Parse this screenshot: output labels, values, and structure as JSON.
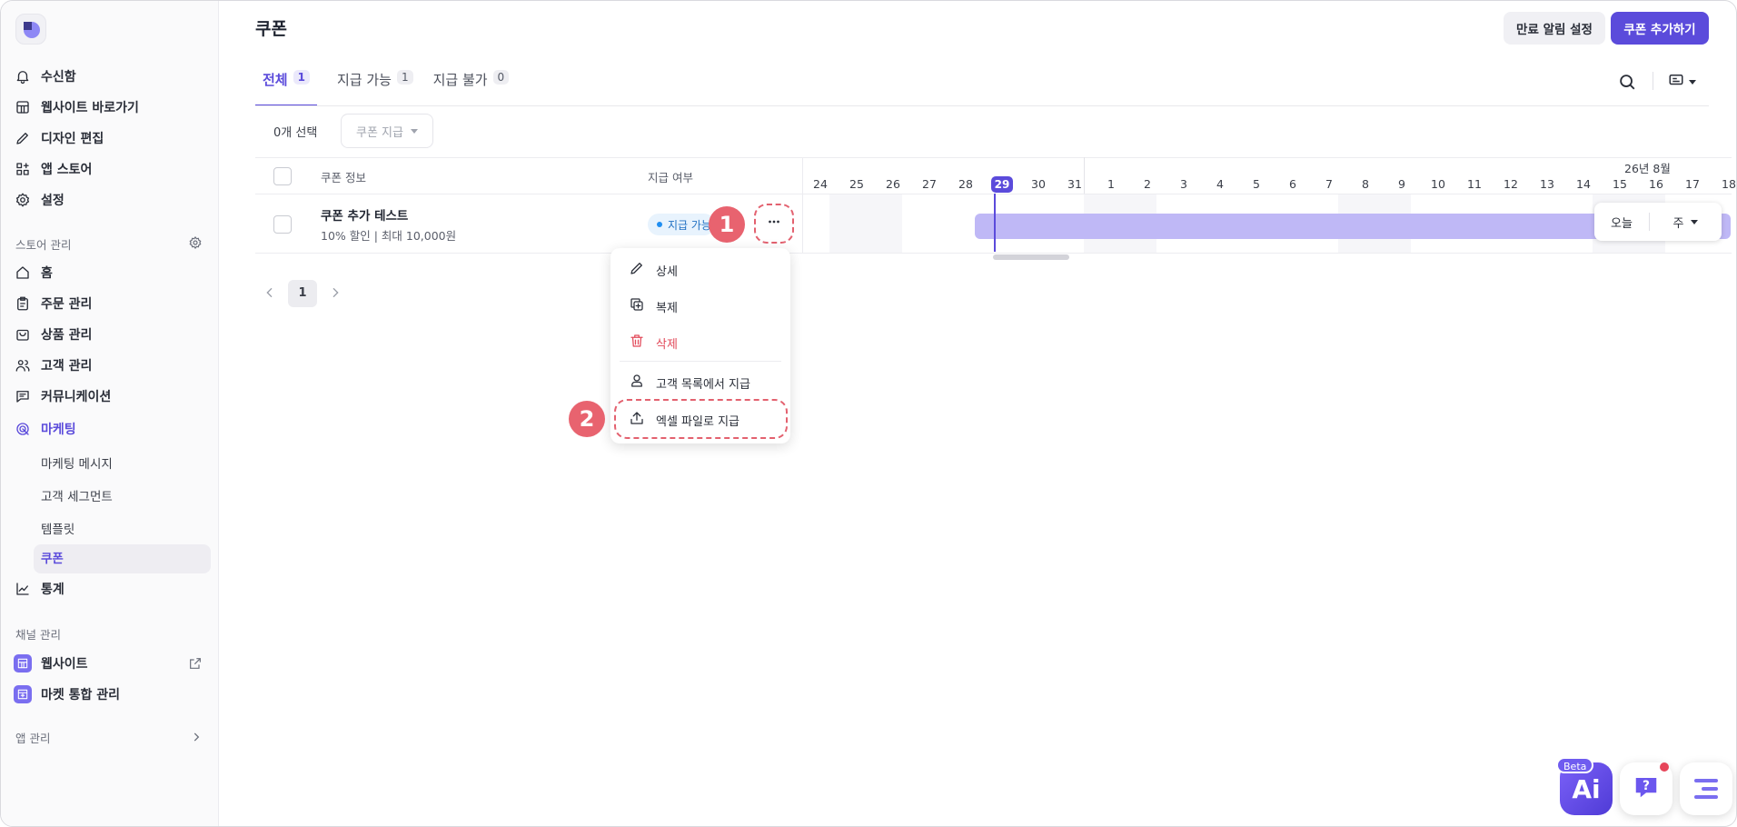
{
  "sidebar": {
    "top_items": [
      {
        "label": "수신함",
        "icon": "bell-icon"
      },
      {
        "label": "웹사이트 바로가기",
        "icon": "store-icon"
      },
      {
        "label": "디자인 편집",
        "icon": "pen-icon"
      },
      {
        "label": "앱 스토어",
        "icon": "apps-icon"
      },
      {
        "label": "설정",
        "icon": "gear-icon"
      }
    ],
    "store_section": "스토어 관리",
    "store_items": [
      {
        "label": "홈"
      },
      {
        "label": "주문 관리"
      },
      {
        "label": "상품 관리"
      },
      {
        "label": "고객 관리"
      },
      {
        "label": "커뮤니케이션"
      },
      {
        "label": "마케팅"
      }
    ],
    "marketing_sub": [
      "마케팅 메시지",
      "고객 세그먼트",
      "템플릿",
      "쿠폰"
    ],
    "stats": "통계",
    "channel_section": "채널 관리",
    "channel_items": [
      {
        "label": "웹사이트"
      },
      {
        "label": "마켓 통합 관리"
      }
    ],
    "app_section": "앱 관리"
  },
  "header": {
    "title": "쿠폰",
    "secondary_button": "만료 알림 설정",
    "primary_button": "쿠폰 추가하기"
  },
  "tabs": [
    {
      "label": "전체",
      "count": "1"
    },
    {
      "label": "지급 가능",
      "count": "1"
    },
    {
      "label": "지급 불가",
      "count": "0"
    }
  ],
  "toolbar": {
    "selection_count": "0개 선택",
    "bulk_action": "쿠폰 지급"
  },
  "table": {
    "col_info": "쿠폰 정보",
    "col_status": "지급 여부",
    "rows": [
      {
        "title": "쿠폰 추가 테스트",
        "subtitle": "10% 할인 | 최대 10,000원",
        "status": "지급 가능"
      }
    ]
  },
  "gantt": {
    "month_label": "26년 8월",
    "days": [
      "24",
      "25",
      "26",
      "27",
      "28",
      "29",
      "30",
      "31",
      "1",
      "2",
      "3",
      "4",
      "5",
      "6",
      "7",
      "8",
      "9",
      "10",
      "11",
      "12",
      "13",
      "14",
      "15",
      "16",
      "17",
      "18"
    ],
    "today_index": 5,
    "today_button": "오늘",
    "view_mode": "주"
  },
  "pagination": {
    "current": "1"
  },
  "context_menu": {
    "items": [
      {
        "label": "상세",
        "icon": "pencil-icon"
      },
      {
        "label": "복제",
        "icon": "copy-icon"
      },
      {
        "label": "삭제",
        "icon": "trash-icon"
      },
      {
        "label": "고객 목록에서 지급",
        "icon": "user-icon"
      },
      {
        "label": "엑셀 파일로 지급",
        "icon": "upload-icon"
      }
    ]
  },
  "markers": [
    "1",
    "2"
  ],
  "floating": {
    "ai_label": "Ai",
    "beta": "Beta"
  },
  "colors": {
    "accent": "#5b4bdb",
    "marker": "#e8636f",
    "bar": "#bfb8f6"
  }
}
